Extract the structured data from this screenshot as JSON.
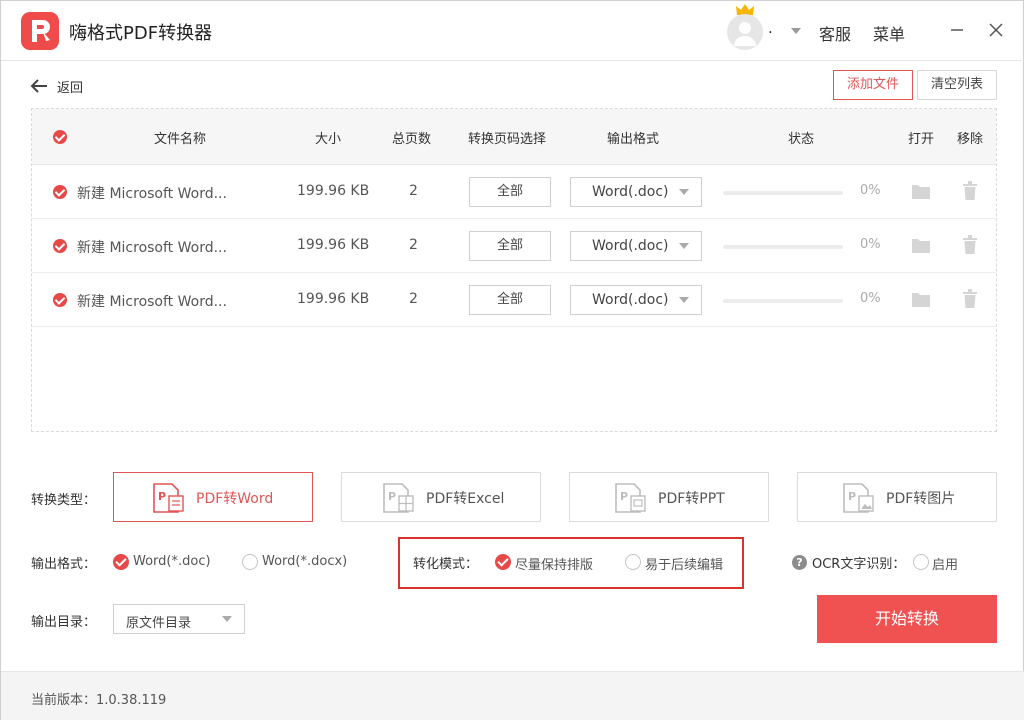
{
  "app": {
    "title": "嗨格式PDF转换器",
    "username": ".",
    "service_label": "客服",
    "menu_label": "菜单"
  },
  "toolbar": {
    "back_label": "返回",
    "add_file_label": "添加文件",
    "clear_list_label": "清空列表"
  },
  "table": {
    "headers": {
      "name": "文件名称",
      "size": "大小",
      "pages": "总页数",
      "page_range": "转换页码选择",
      "format": "输出格式",
      "status": "状态",
      "open": "打开",
      "remove": "移除"
    },
    "rows": [
      {
        "name": "新建 Microsoft Word...",
        "size": "199.96 KB",
        "pages": "2",
        "range": "全部",
        "format": "Word(.doc)",
        "progress": 0,
        "progress_label": "0%"
      },
      {
        "name": "新建 Microsoft Word...",
        "size": "199.96 KB",
        "pages": "2",
        "range": "全部",
        "format": "Word(.doc)",
        "progress": 0,
        "progress_label": "0%"
      },
      {
        "name": "新建 Microsoft Word...",
        "size": "199.96 KB",
        "pages": "2",
        "range": "全部",
        "format": "Word(.doc)",
        "progress": 0,
        "progress_label": "0%"
      }
    ]
  },
  "convert_type": {
    "label": "转换类型：",
    "options": [
      "PDF转Word",
      "PDF转Excel",
      "PDF转PPT",
      "PDF转图片"
    ],
    "selected": "PDF转Word"
  },
  "output_format": {
    "label": "输出格式：",
    "options": [
      "Word(*.doc)",
      "Word(*.docx)"
    ],
    "selected": "Word(*.doc)"
  },
  "convert_mode": {
    "label": "转化模式：",
    "options": [
      "尽量保持排版",
      "易于后续编辑"
    ],
    "selected": "尽量保持排版"
  },
  "ocr": {
    "label": "OCR文字识别：",
    "help_glyph": "?",
    "option": "启用",
    "enabled": false
  },
  "output_dir": {
    "label": "输出目录：",
    "value": "原文件目录"
  },
  "start_button_label": "开始转换",
  "footer": {
    "version_label": "当前版本：1.0.38.119"
  },
  "colors": {
    "accent": "#e74848",
    "start_button": "#f05252",
    "highlight_border": "#d8342c"
  }
}
